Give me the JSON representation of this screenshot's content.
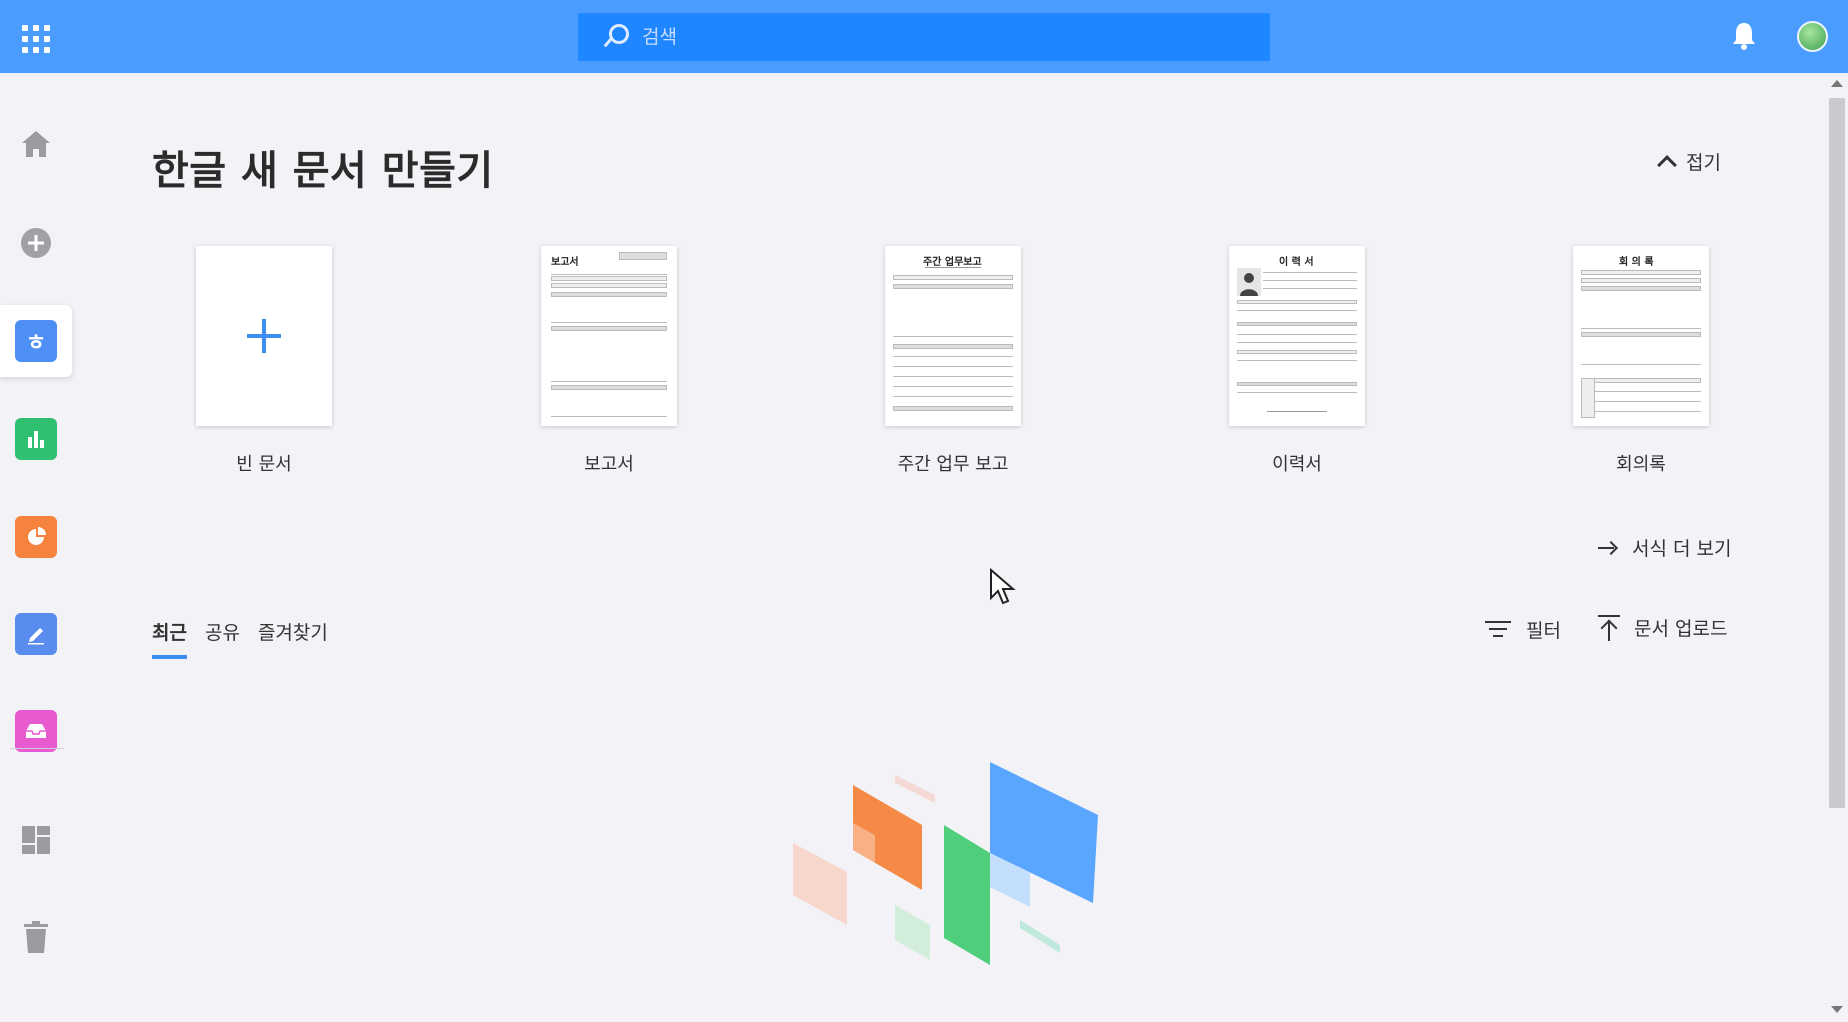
{
  "topbar": {
    "search_placeholder": "검색",
    "accent_color": "#4a9cff"
  },
  "sidebar": {
    "items": [
      {
        "name": "home",
        "icon": "home-icon"
      },
      {
        "name": "new",
        "icon": "plus-circle-icon"
      },
      {
        "name": "hangul",
        "icon": "hangul-app-icon",
        "glyph": "ㅎ",
        "color": "#4d8ff5",
        "active": true
      },
      {
        "name": "cell",
        "icon": "bar-chart-app-icon",
        "color": "#2fbf71"
      },
      {
        "name": "show",
        "icon": "pie-chart-app-icon",
        "color": "#f5823d"
      },
      {
        "name": "draw",
        "icon": "pen-app-icon",
        "color": "#5a8cf0"
      },
      {
        "name": "inbox",
        "icon": "inbox-app-icon",
        "color": "#e85ad0"
      },
      {
        "name": "dashboard",
        "icon": "dashboard-icon"
      },
      {
        "name": "trash",
        "icon": "trash-icon"
      }
    ]
  },
  "main": {
    "title": "한글 새 문서 만들기",
    "collapse_label": "접기",
    "templates": [
      {
        "label": "빈 문서"
      },
      {
        "label": "보고서",
        "doc_title": "보고서"
      },
      {
        "label": "주간 업무 보고",
        "doc_title": "주간 업무보고"
      },
      {
        "label": "이력서",
        "doc_title": "이 력 서"
      },
      {
        "label": "회의록",
        "doc_title": "회 의 록"
      }
    ],
    "more_templates_label": "서식 더 보기",
    "tabs": [
      {
        "label": "최근",
        "active": true
      },
      {
        "label": "공유"
      },
      {
        "label": "즐겨찾기"
      }
    ],
    "filter_label": "필터",
    "upload_label": "문서 업로드"
  }
}
